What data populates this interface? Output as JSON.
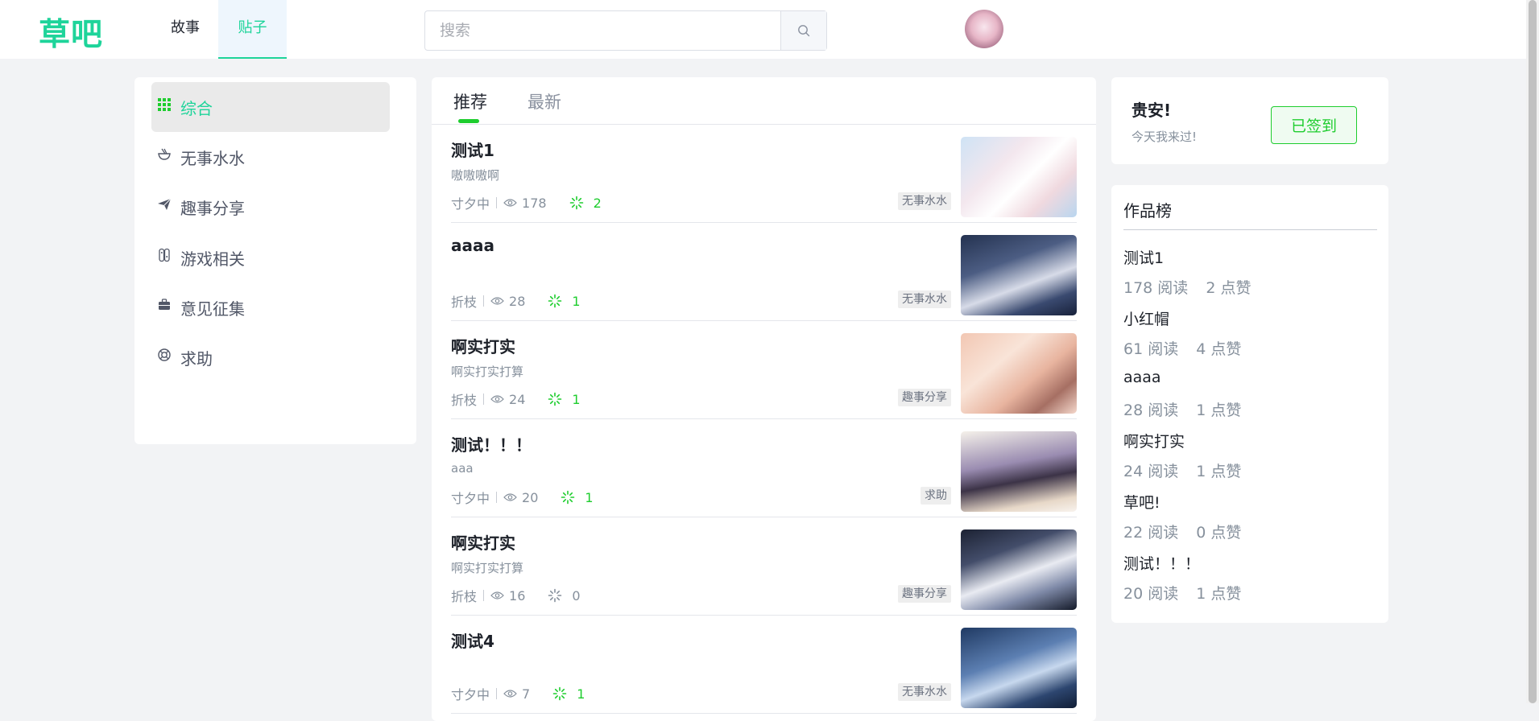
{
  "header": {
    "logo": "草吧",
    "nav": [
      {
        "label": "故事"
      },
      {
        "label": "贴子"
      }
    ],
    "search_placeholder": "搜索",
    "accent_color": "#1ed49a"
  },
  "sidebar": {
    "items": [
      {
        "label": "综合",
        "icon": "grid-icon"
      },
      {
        "label": "无事水水",
        "icon": "bowl-icon"
      },
      {
        "label": "趣事分享",
        "icon": "paper-plane-icon"
      },
      {
        "label": "游戏相关",
        "icon": "game-controller-icon"
      },
      {
        "label": "意见征集",
        "icon": "briefcase-icon"
      },
      {
        "label": "求助",
        "icon": "lifebuoy-icon"
      }
    ]
  },
  "feed": {
    "tabs": [
      {
        "label": "推荐"
      },
      {
        "label": "最新"
      }
    ],
    "posts": [
      {
        "title": "测试1",
        "summary": "嗷嗷嗷啊",
        "author": "寸夕中",
        "views": "178",
        "likes": "2",
        "tag": "无事水水"
      },
      {
        "title": "aaaa",
        "summary": "",
        "author": "折枝",
        "views": "28",
        "likes": "1",
        "tag": "无事水水"
      },
      {
        "title": "啊实打实",
        "summary": "啊实打实打算",
        "author": "折枝",
        "views": "24",
        "likes": "1",
        "tag": "趣事分享"
      },
      {
        "title": "测试！！！",
        "summary": "aaa",
        "author": "寸夕中",
        "views": "20",
        "likes": "1",
        "tag": "求助"
      },
      {
        "title": "啊实打实",
        "summary": "啊实打实打算",
        "author": "折枝",
        "views": "16",
        "likes": "0",
        "tag": "趣事分享"
      },
      {
        "title": "测试4",
        "summary": "",
        "author": "寸夕中",
        "views": "7",
        "likes": "1",
        "tag": "无事水水"
      }
    ]
  },
  "checkin": {
    "title": "贵安!",
    "subtitle": "今天我来过!",
    "button_label": "已签到"
  },
  "ranking": {
    "title": "作品榜",
    "items": [
      {
        "title": "测试1",
        "reads": "178 阅读",
        "likes": "2 点赞"
      },
      {
        "title": "小红帽",
        "reads": "61 阅读",
        "likes": "4 点赞"
      },
      {
        "title": "aaaa",
        "reads": "28 阅读",
        "likes": "1 点赞"
      },
      {
        "title": "啊实打实",
        "reads": "24 阅读",
        "likes": "1 点赞"
      },
      {
        "title": "草吧!",
        "reads": "22 阅读",
        "likes": "0 点赞"
      },
      {
        "title": "测试！！！",
        "reads": "20 阅读",
        "likes": "1 点赞"
      }
    ]
  }
}
